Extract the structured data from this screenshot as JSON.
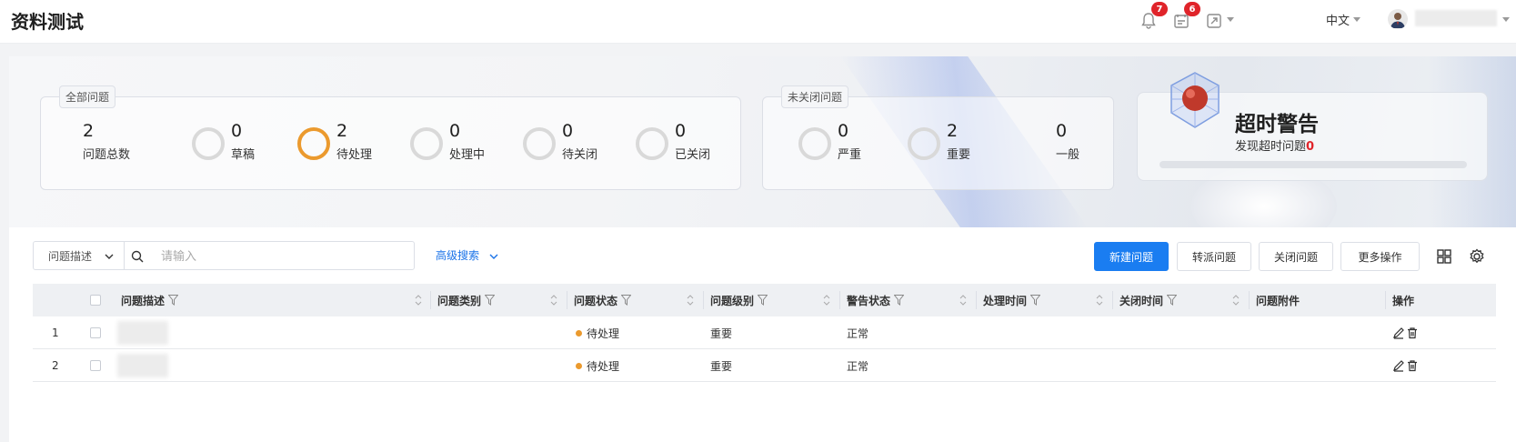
{
  "app": {
    "title": "资料测试"
  },
  "header": {
    "notification_count": "7",
    "task_count": "6",
    "language": "中文",
    "username": ""
  },
  "summary": {
    "all": {
      "tag": "全部问题",
      "stats": [
        {
          "value": "2",
          "label": "问题总数"
        },
        {
          "value": "0",
          "label": "草稿"
        },
        {
          "value": "2",
          "label": "待处理"
        },
        {
          "value": "0",
          "label": "处理中"
        },
        {
          "value": "0",
          "label": "待关闭"
        },
        {
          "value": "0",
          "label": "已关闭"
        }
      ]
    },
    "open": {
      "tag": "未关闭问题",
      "stats": [
        {
          "value": "0",
          "label": "严重"
        },
        {
          "value": "2",
          "label": "重要"
        },
        {
          "value": "0",
          "label": "一般"
        }
      ]
    },
    "timeout": {
      "title": "超时警告",
      "subtitle": "发现超时问题",
      "count": "0"
    }
  },
  "toolbar": {
    "search_field": "问题描述",
    "search_placeholder": "请输入",
    "advanced_search": "高级搜索",
    "buttons": {
      "new": "新建问题",
      "transfer": "转派问题",
      "close": "关闭问题",
      "more": "更多操作"
    }
  },
  "table": {
    "columns": [
      "问题描述",
      "问题类别",
      "问题状态",
      "问题级别",
      "警告状态",
      "处理时间",
      "关闭时间",
      "问题附件",
      "操作"
    ],
    "rows": [
      {
        "index": "1",
        "status": "待处理",
        "level": "重要",
        "warning": "正常"
      },
      {
        "index": "2",
        "status": "待处理",
        "level": "重要",
        "warning": "正常"
      }
    ]
  },
  "colors": {
    "primary": "#1a7df1",
    "pending": "#eb9a2e",
    "badge": "#e0242a"
  }
}
